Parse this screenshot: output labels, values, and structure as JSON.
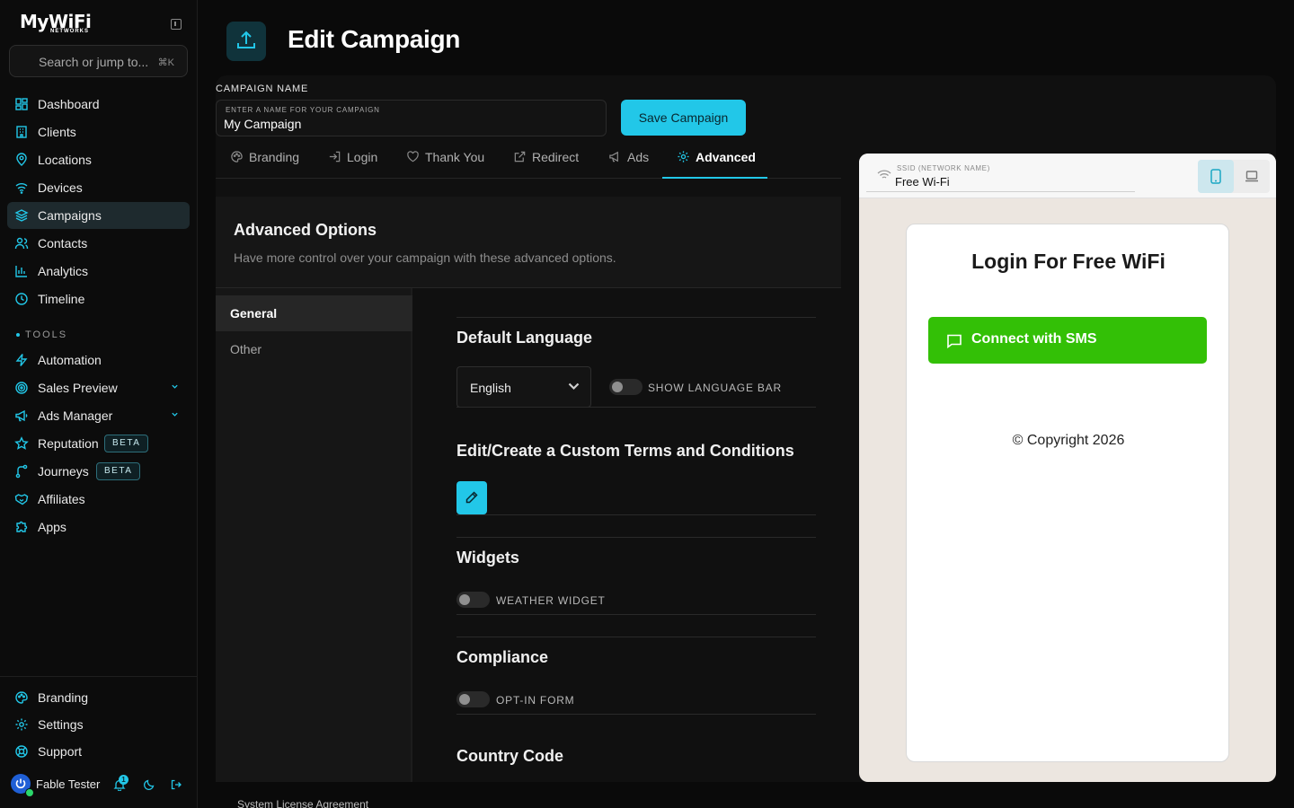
{
  "app": {
    "logo_main": "MyWiFi",
    "logo_sub": "NETWORKS"
  },
  "search": {
    "placeholder": "Search or jump to...",
    "shortcut": "⌘K"
  },
  "sidebar": {
    "main_items": [
      {
        "label": "Dashboard",
        "icon": "dashboard-icon"
      },
      {
        "label": "Clients",
        "icon": "building-icon"
      },
      {
        "label": "Locations",
        "icon": "map-pin-icon"
      },
      {
        "label": "Devices",
        "icon": "wifi-icon"
      },
      {
        "label": "Campaigns",
        "icon": "layers-icon",
        "active": true
      },
      {
        "label": "Contacts",
        "icon": "users-icon"
      },
      {
        "label": "Analytics",
        "icon": "bar-chart-icon"
      },
      {
        "label": "Timeline",
        "icon": "clock-icon"
      }
    ],
    "tools_heading": "TOOLS",
    "tool_items": [
      {
        "label": "Automation",
        "icon": "bolt-icon"
      },
      {
        "label": "Sales Preview",
        "icon": "target-icon",
        "chevron": true
      },
      {
        "label": "Ads Manager",
        "icon": "megaphone-icon",
        "chevron": true
      },
      {
        "label": "Reputation",
        "icon": "star-icon",
        "badge": "BETA"
      },
      {
        "label": "Journeys",
        "icon": "route-icon",
        "badge": "BETA"
      },
      {
        "label": "Affiliates",
        "icon": "handshake-icon"
      },
      {
        "label": "Apps",
        "icon": "puzzle-icon"
      }
    ],
    "bottom_items": [
      {
        "label": "Branding",
        "icon": "palette-icon"
      },
      {
        "label": "Settings",
        "icon": "gear-icon"
      },
      {
        "label": "Support",
        "icon": "lifebuoy-icon"
      }
    ],
    "user": {
      "name": "Fable Tester",
      "notification_count": "1"
    }
  },
  "header": {
    "title": "Edit Campaign"
  },
  "campaign": {
    "name_label": "CAMPAIGN NAME",
    "input_label": "ENTER A NAME FOR YOUR CAMPAIGN",
    "input_value": "My Campaign",
    "save_label": "Save Campaign"
  },
  "tabs": [
    {
      "label": "Branding",
      "icon": "palette-icon"
    },
    {
      "label": "Login",
      "icon": "login-icon"
    },
    {
      "label": "Thank You",
      "icon": "heart-icon"
    },
    {
      "label": "Redirect",
      "icon": "external-link-icon"
    },
    {
      "label": "Ads",
      "icon": "megaphone-icon"
    },
    {
      "label": "Advanced",
      "icon": "gear-icon",
      "active": true
    }
  ],
  "advanced": {
    "title": "Advanced Options",
    "subtitle": "Have more control over your campaign with these advanced options.",
    "subnav": [
      {
        "label": "General",
        "active": true
      },
      {
        "label": "Other"
      }
    ],
    "sections": {
      "language": {
        "title": "Default Language",
        "selected": "English",
        "toggle_label": "SHOW LANGUAGE BAR",
        "toggle_on": false
      },
      "terms": {
        "title": "Edit/Create a Custom Terms and Conditions"
      },
      "widgets": {
        "title": "Widgets",
        "toggle_label": "WEATHER WIDGET",
        "toggle_on": false
      },
      "compliance": {
        "title": "Compliance",
        "toggle_label": "OPT-IN FORM",
        "toggle_on": false
      },
      "country": {
        "title": "Country Code"
      }
    }
  },
  "footer": {
    "license": "System License Agreement"
  },
  "preview": {
    "ssid_label": "SSID (NETWORK NAME)",
    "ssid_value": "Free Wi-Fi",
    "title": "Login For Free WiFi",
    "sms_button": "Connect with SMS",
    "copyright": "© Copyright 2026"
  },
  "colors": {
    "accent": "#22c7e8",
    "sms_green": "#33c006"
  }
}
